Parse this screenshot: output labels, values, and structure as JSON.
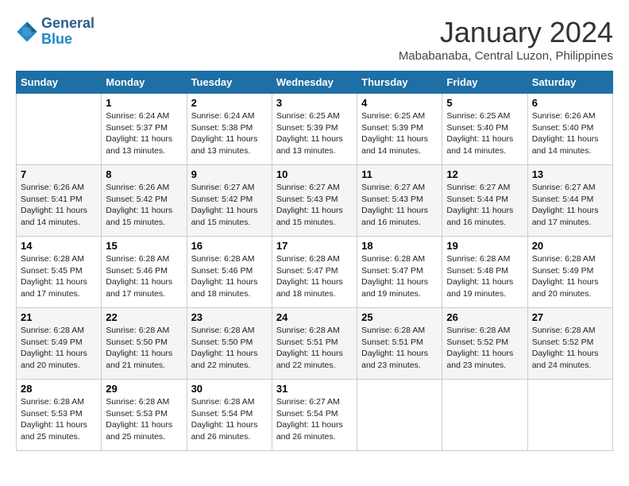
{
  "header": {
    "logo_line1": "General",
    "logo_line2": "Blue",
    "month": "January 2024",
    "location": "Mababanaba, Central Luzon, Philippines"
  },
  "weekdays": [
    "Sunday",
    "Monday",
    "Tuesday",
    "Wednesday",
    "Thursday",
    "Friday",
    "Saturday"
  ],
  "weeks": [
    [
      {
        "day": "",
        "info": ""
      },
      {
        "day": "1",
        "info": "Sunrise: 6:24 AM\nSunset: 5:37 PM\nDaylight: 11 hours\nand 13 minutes."
      },
      {
        "day": "2",
        "info": "Sunrise: 6:24 AM\nSunset: 5:38 PM\nDaylight: 11 hours\nand 13 minutes."
      },
      {
        "day": "3",
        "info": "Sunrise: 6:25 AM\nSunset: 5:39 PM\nDaylight: 11 hours\nand 13 minutes."
      },
      {
        "day": "4",
        "info": "Sunrise: 6:25 AM\nSunset: 5:39 PM\nDaylight: 11 hours\nand 14 minutes."
      },
      {
        "day": "5",
        "info": "Sunrise: 6:25 AM\nSunset: 5:40 PM\nDaylight: 11 hours\nand 14 minutes."
      },
      {
        "day": "6",
        "info": "Sunrise: 6:26 AM\nSunset: 5:40 PM\nDaylight: 11 hours\nand 14 minutes."
      }
    ],
    [
      {
        "day": "7",
        "info": "Sunrise: 6:26 AM\nSunset: 5:41 PM\nDaylight: 11 hours\nand 14 minutes."
      },
      {
        "day": "8",
        "info": "Sunrise: 6:26 AM\nSunset: 5:42 PM\nDaylight: 11 hours\nand 15 minutes."
      },
      {
        "day": "9",
        "info": "Sunrise: 6:27 AM\nSunset: 5:42 PM\nDaylight: 11 hours\nand 15 minutes."
      },
      {
        "day": "10",
        "info": "Sunrise: 6:27 AM\nSunset: 5:43 PM\nDaylight: 11 hours\nand 15 minutes."
      },
      {
        "day": "11",
        "info": "Sunrise: 6:27 AM\nSunset: 5:43 PM\nDaylight: 11 hours\nand 16 minutes."
      },
      {
        "day": "12",
        "info": "Sunrise: 6:27 AM\nSunset: 5:44 PM\nDaylight: 11 hours\nand 16 minutes."
      },
      {
        "day": "13",
        "info": "Sunrise: 6:27 AM\nSunset: 5:44 PM\nDaylight: 11 hours\nand 17 minutes."
      }
    ],
    [
      {
        "day": "14",
        "info": "Sunrise: 6:28 AM\nSunset: 5:45 PM\nDaylight: 11 hours\nand 17 minutes."
      },
      {
        "day": "15",
        "info": "Sunrise: 6:28 AM\nSunset: 5:46 PM\nDaylight: 11 hours\nand 17 minutes."
      },
      {
        "day": "16",
        "info": "Sunrise: 6:28 AM\nSunset: 5:46 PM\nDaylight: 11 hours\nand 18 minutes."
      },
      {
        "day": "17",
        "info": "Sunrise: 6:28 AM\nSunset: 5:47 PM\nDaylight: 11 hours\nand 18 minutes."
      },
      {
        "day": "18",
        "info": "Sunrise: 6:28 AM\nSunset: 5:47 PM\nDaylight: 11 hours\nand 19 minutes."
      },
      {
        "day": "19",
        "info": "Sunrise: 6:28 AM\nSunset: 5:48 PM\nDaylight: 11 hours\nand 19 minutes."
      },
      {
        "day": "20",
        "info": "Sunrise: 6:28 AM\nSunset: 5:49 PM\nDaylight: 11 hours\nand 20 minutes."
      }
    ],
    [
      {
        "day": "21",
        "info": "Sunrise: 6:28 AM\nSunset: 5:49 PM\nDaylight: 11 hours\nand 20 minutes."
      },
      {
        "day": "22",
        "info": "Sunrise: 6:28 AM\nSunset: 5:50 PM\nDaylight: 11 hours\nand 21 minutes."
      },
      {
        "day": "23",
        "info": "Sunrise: 6:28 AM\nSunset: 5:50 PM\nDaylight: 11 hours\nand 22 minutes."
      },
      {
        "day": "24",
        "info": "Sunrise: 6:28 AM\nSunset: 5:51 PM\nDaylight: 11 hours\nand 22 minutes."
      },
      {
        "day": "25",
        "info": "Sunrise: 6:28 AM\nSunset: 5:51 PM\nDaylight: 11 hours\nand 23 minutes."
      },
      {
        "day": "26",
        "info": "Sunrise: 6:28 AM\nSunset: 5:52 PM\nDaylight: 11 hours\nand 23 minutes."
      },
      {
        "day": "27",
        "info": "Sunrise: 6:28 AM\nSunset: 5:52 PM\nDaylight: 11 hours\nand 24 minutes."
      }
    ],
    [
      {
        "day": "28",
        "info": "Sunrise: 6:28 AM\nSunset: 5:53 PM\nDaylight: 11 hours\nand 25 minutes."
      },
      {
        "day": "29",
        "info": "Sunrise: 6:28 AM\nSunset: 5:53 PM\nDaylight: 11 hours\nand 25 minutes."
      },
      {
        "day": "30",
        "info": "Sunrise: 6:28 AM\nSunset: 5:54 PM\nDaylight: 11 hours\nand 26 minutes."
      },
      {
        "day": "31",
        "info": "Sunrise: 6:27 AM\nSunset: 5:54 PM\nDaylight: 11 hours\nand 26 minutes."
      },
      {
        "day": "",
        "info": ""
      },
      {
        "day": "",
        "info": ""
      },
      {
        "day": "",
        "info": ""
      }
    ]
  ]
}
